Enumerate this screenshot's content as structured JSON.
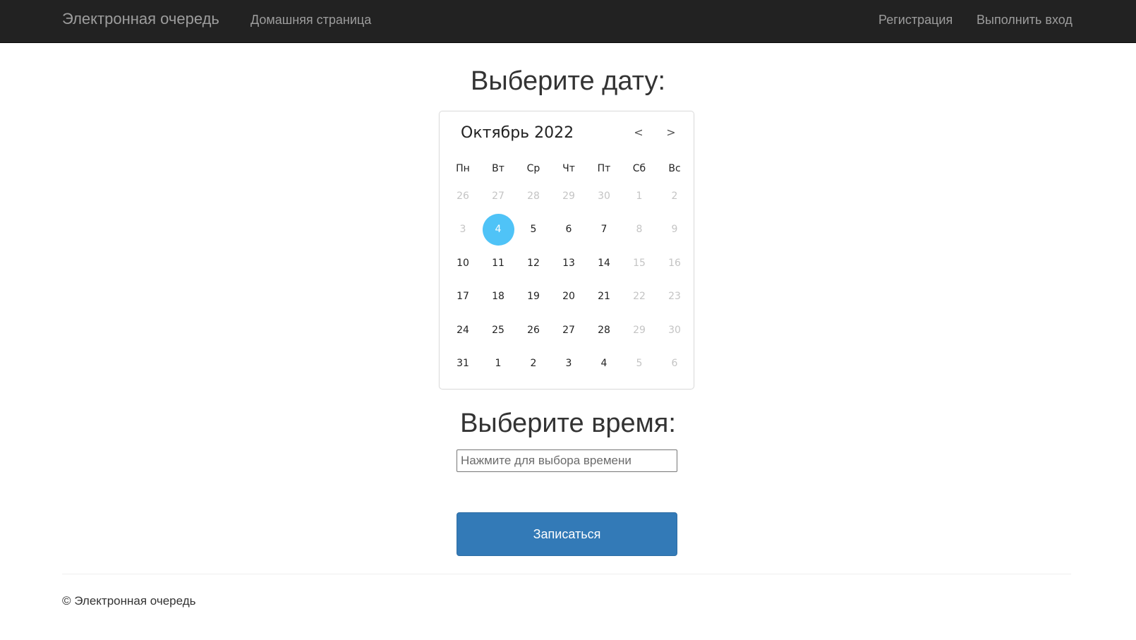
{
  "navbar": {
    "brand": "Электронная очередь",
    "home": "Домашняя страница",
    "register": "Регистрация",
    "login": "Выполнить вход"
  },
  "date_section": {
    "heading": "Выберите дату:"
  },
  "calendar": {
    "month_label": "Октябрь 2022",
    "prev_label": "<",
    "next_label": ">",
    "weekdays": [
      "Пн",
      "Вт",
      "Ср",
      "Чт",
      "Пт",
      "Сб",
      "Вс"
    ],
    "weeks": [
      [
        {
          "d": "26",
          "m": 1
        },
        {
          "d": "27",
          "m": 1
        },
        {
          "d": "28",
          "m": 1
        },
        {
          "d": "29",
          "m": 1
        },
        {
          "d": "30",
          "m": 1
        },
        {
          "d": "1",
          "m": 1
        },
        {
          "d": "2",
          "m": 1
        }
      ],
      [
        {
          "d": "3",
          "m": 1
        },
        {
          "d": "4",
          "s": 1
        },
        {
          "d": "5"
        },
        {
          "d": "6"
        },
        {
          "d": "7"
        },
        {
          "d": "8",
          "m": 1
        },
        {
          "d": "9",
          "m": 1
        }
      ],
      [
        {
          "d": "10"
        },
        {
          "d": "11"
        },
        {
          "d": "12"
        },
        {
          "d": "13"
        },
        {
          "d": "14"
        },
        {
          "d": "15",
          "m": 1
        },
        {
          "d": "16",
          "m": 1
        }
      ],
      [
        {
          "d": "17"
        },
        {
          "d": "18"
        },
        {
          "d": "19"
        },
        {
          "d": "20"
        },
        {
          "d": "21"
        },
        {
          "d": "22",
          "m": 1
        },
        {
          "d": "23",
          "m": 1
        }
      ],
      [
        {
          "d": "24"
        },
        {
          "d": "25"
        },
        {
          "d": "26"
        },
        {
          "d": "27"
        },
        {
          "d": "28"
        },
        {
          "d": "29",
          "m": 1
        },
        {
          "d": "30",
          "m": 1
        }
      ],
      [
        {
          "d": "31"
        },
        {
          "d": "1"
        },
        {
          "d": "2"
        },
        {
          "d": "3"
        },
        {
          "d": "4"
        },
        {
          "d": "5",
          "m": 1
        },
        {
          "d": "6",
          "m": 1
        }
      ]
    ],
    "selected_color": "#4fc3f7"
  },
  "time_section": {
    "heading": "Выберите время:",
    "placeholder": "Нажмите для выбора времени"
  },
  "submit": {
    "label": "Записаться",
    "color": "#337ab7"
  },
  "footer": {
    "text": "© Электронная очередь"
  }
}
